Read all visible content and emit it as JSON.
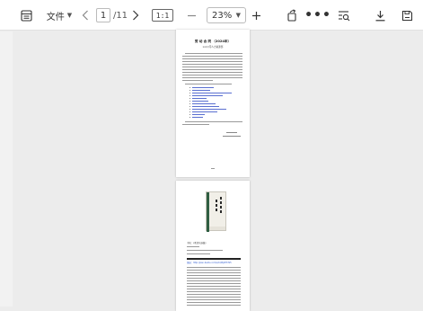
{
  "toolbar": {
    "file_label": "文件",
    "page_current": "1",
    "page_total": "/11",
    "fit_label": "1:1",
    "zoom_value": "23%"
  },
  "document": {
    "page1": {
      "title": "劳 动 合 同 （2024年）",
      "subtitle": "xxx公司人力资源部"
    },
    "page2": {
      "caption_1": "书名：《毛泽东选集》",
      "caption_2": "链接：http://pan.baidu.com/s/1Q8jkHhTz5"
    }
  },
  "colors": {
    "toolbar_bg": "#ffffff",
    "canvas_bg": "#ececec",
    "link": "#2f5bd0",
    "book_green": "#2f5e42"
  }
}
